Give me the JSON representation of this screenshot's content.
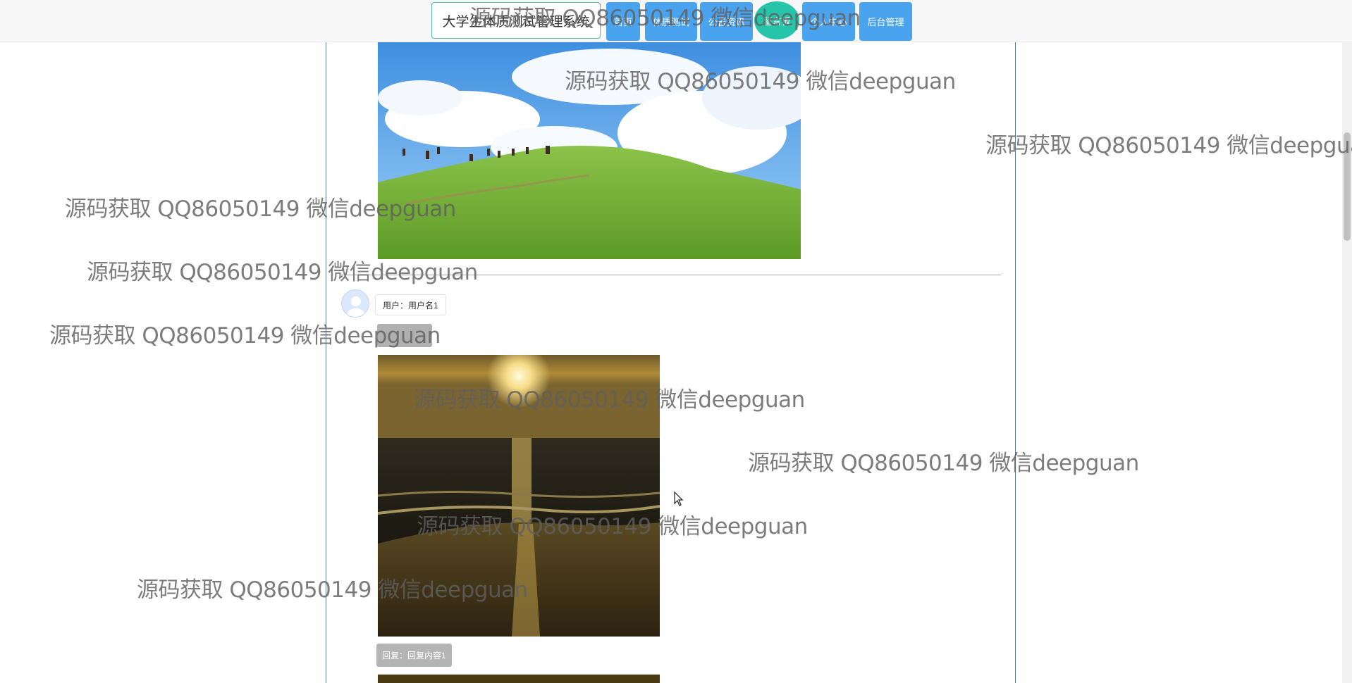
{
  "header": {
    "brand": "大学生体质测试管理系统",
    "nav": [
      "首页",
      "体质测试",
      "公告资讯",
      "留言板",
      "个人中心",
      "后台管理"
    ],
    "active_index": 3
  },
  "post": {
    "user_label": "用户：用户名1",
    "reply_label": "回复：回复内容1"
  },
  "watermark": {
    "text": "源码获取 QQ86050149 微信deepguan"
  },
  "colors": {
    "nav_button": "#4aa3ef",
    "nav_active": "#26c4a8",
    "frame_line": "#5a7aa0"
  },
  "icons": {
    "avatar": "user-avatar-icon",
    "cursor": "mouse-pointer-icon"
  }
}
